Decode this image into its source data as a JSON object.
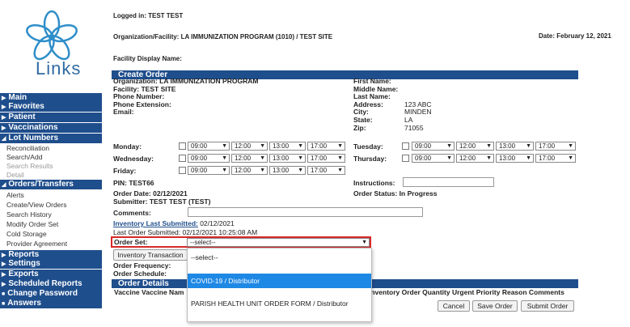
{
  "header": {
    "logged_in": "Logged in: TEST TEST",
    "org_facility": "Organization/Facility: LA IMMUNIZATION PROGRAM (1010) / TEST SITE",
    "date": "Date: February 12, 2021",
    "facility_display": "Facility Display Name:",
    "logo_text": "Links"
  },
  "sidebar": {
    "main": "Main",
    "favorites": "Favorites",
    "patient": "Patient",
    "vaccinations": "Vaccinations",
    "lot_numbers": "Lot Numbers",
    "lot_items": [
      "Reconciliation",
      "Search/Add",
      "Search Results",
      "Detail"
    ],
    "orders_transfers": "Orders/Transfers",
    "order_items": [
      "Alerts",
      "Create/View Orders",
      "Search History",
      "Modify Order Set",
      "Cold Storage",
      "Provider Agreement"
    ],
    "reports": "Reports",
    "settings": "Settings",
    "exports": "Exports",
    "scheduled_reports": "Scheduled Reports",
    "change_password": "Change Password",
    "answers": "Answers"
  },
  "create_order": {
    "title": "Create Order",
    "organization": "Organization:  LA IMMUNIZATION PROGRAM",
    "facility": "Facility:  TEST SITE",
    "phone_number": "Phone Number:",
    "phone_extension": "Phone Extension:",
    "email": "Email:",
    "first_name": "First Name:",
    "middle_name": "Middle Name:",
    "last_name": "Last Name:",
    "address_label": "Address:",
    "address_value": "123 ABC",
    "city_label": "City:",
    "city_value": "MINDEN",
    "state_label": "State:",
    "state_value": "LA",
    "zip_label": "Zip:",
    "zip_value": "71055",
    "days": {
      "monday": "Monday:",
      "wednesday": "Wednesday:",
      "friday": "Friday:",
      "tuesday": "Tuesday:",
      "thursday": "Thursday:"
    },
    "times": [
      "09:00",
      "12:00",
      "13:00",
      "17:00"
    ],
    "pin": "PIN:  TEST66",
    "instructions": "Instructions:",
    "order_date": "Order Date:  02/12/2021",
    "order_status": "Order Status:  In Progress",
    "submitter": "Submitter:  TEST TEST (TEST)",
    "comments": "Comments:",
    "inventory_link": "Inventory Last Submitted:",
    "inventory_date": " 02/12/2021",
    "last_order": "Last Order Submitted: 02/12/2021 10:25:08 AM",
    "order_set_label": "Order Set:",
    "order_set_value": "--select--",
    "inventory_btn": "Inventory Transaction",
    "order_frequency": "Order Frequency:",
    "order_schedule": "Order Schedule:"
  },
  "order_details": {
    "title": "Order Details",
    "col_left": "Vaccine Vaccine Nam",
    "col_right": "Inventory Order Quantity Urgent Priority Reason Comments"
  },
  "dropdown": {
    "options": [
      "--select--",
      "COVID-19 / Distributor",
      "PARISH HEALTH UNIT ORDER FORM / Distributor"
    ]
  },
  "buttons": {
    "cancel": "Cancel",
    "save": "Save Order",
    "submit": "Submit Order"
  },
  "colors": {
    "nav_blue": "#1f4e8c",
    "highlight": "#1e88e5",
    "focus_red": "#d62828"
  }
}
